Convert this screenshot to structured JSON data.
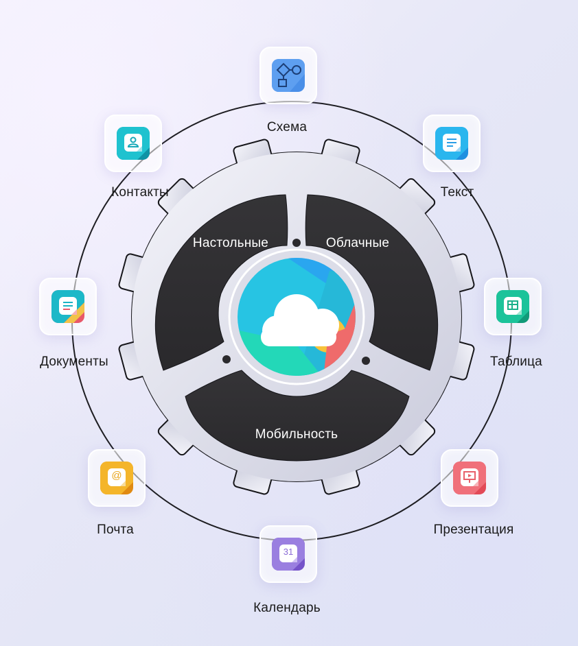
{
  "center": {
    "icon": "cloud-icon"
  },
  "segments": {
    "desktop": "Настольные",
    "cloud": "Облачные",
    "mobility": "Мобильность"
  },
  "apps": [
    {
      "id": "schema",
      "label": "Схема",
      "icon": "flowchart-icon",
      "color": "#4a8fe8"
    },
    {
      "id": "text",
      "label": "Текст",
      "icon": "text-document-icon",
      "color": "#2a9ee6"
    },
    {
      "id": "table",
      "label": "Таблица",
      "icon": "spreadsheet-icon",
      "color": "#1bb08a"
    },
    {
      "id": "presentation",
      "label": "Презентация",
      "icon": "presentation-icon",
      "color": "#e8606a"
    },
    {
      "id": "calendar",
      "label": "Календарь",
      "icon": "calendar-icon",
      "color": "#8a6bd6",
      "glyph": "31"
    },
    {
      "id": "mail",
      "label": "Почта",
      "icon": "mail-icon",
      "color": "#e8a418",
      "glyph": "@"
    },
    {
      "id": "documents",
      "label": "Документы",
      "icon": "documents-icon",
      "color": "#19b3c4"
    },
    {
      "id": "contacts",
      "label": "Контакты",
      "icon": "contacts-icon",
      "color": "#18a9b8"
    }
  ]
}
